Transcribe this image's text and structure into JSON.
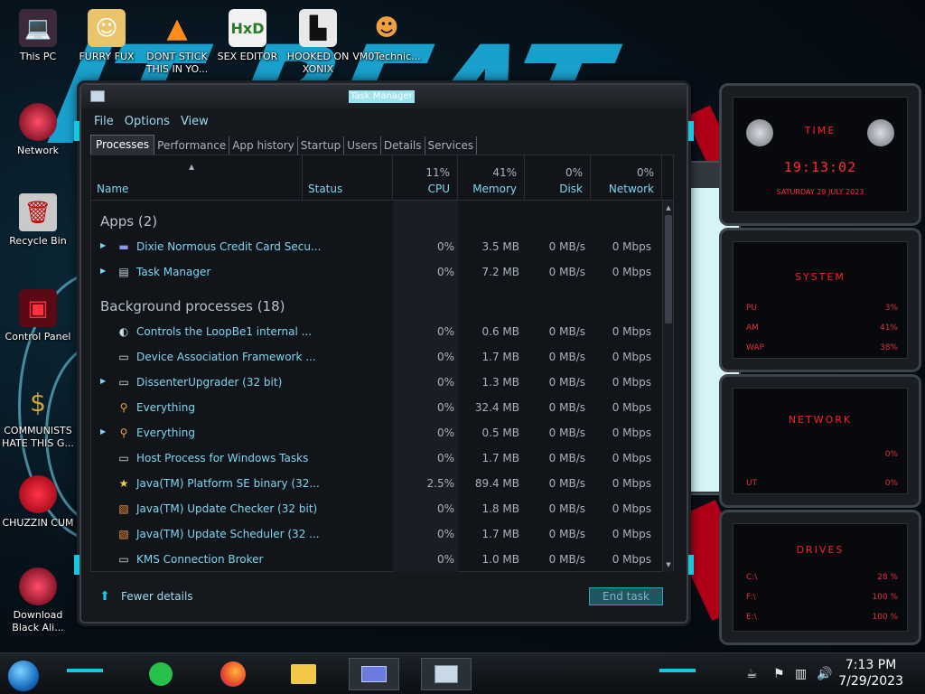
{
  "desktop": {
    "icons": [
      {
        "label": "This PC"
      },
      {
        "label": "FURRY FUX"
      },
      {
        "label": "DONT STICK THIS IN YO..."
      },
      {
        "label": "SEX EDITOR"
      },
      {
        "label": "HOOKED ON XONIX"
      },
      {
        "label": "VM0Technic..."
      },
      {
        "label": "Network"
      },
      {
        "label": "Recycle Bin"
      },
      {
        "label": "Control Panel"
      },
      {
        "label": "COMMUNISTS HATE THIS G..."
      },
      {
        "label": "CHUZZIN CUM"
      },
      {
        "label": "Download Black Ali..."
      }
    ]
  },
  "task_manager": {
    "title": "Task Manager",
    "menu": [
      "File",
      "Options",
      "View"
    ],
    "tabs": [
      "Processes",
      "Performance",
      "App history",
      "Startup",
      "Users",
      "Details",
      "Services"
    ],
    "active_tab": "Processes",
    "columns": {
      "name": "Name",
      "status": "Status",
      "cpu_pct": "11%",
      "cpu": "CPU",
      "mem_pct": "41%",
      "mem": "Memory",
      "disk_pct": "0%",
      "disk": "Disk",
      "net_pct": "0%",
      "net": "Network"
    },
    "groups": {
      "apps": "Apps (2)",
      "background": "Background processes (18)"
    },
    "apps": [
      {
        "name": "Dixie Normous Credit Card Secu...",
        "cpu": "0%",
        "mem": "3.5 MB",
        "disk": "0 MB/s",
        "net": "0 Mbps",
        "expand": true,
        "icon": "card-icon"
      },
      {
        "name": "Task Manager",
        "cpu": "0%",
        "mem": "7.2 MB",
        "disk": "0 MB/s",
        "net": "0 Mbps",
        "expand": true,
        "icon": "taskmgr-icon"
      }
    ],
    "background": [
      {
        "name": "Controls the LoopBe1 internal ...",
        "cpu": "0%",
        "mem": "0.6 MB",
        "disk": "0 MB/s",
        "net": "0 Mbps",
        "expand": false,
        "icon": "loop-icon"
      },
      {
        "name": "Device Association Framework ...",
        "cpu": "0%",
        "mem": "1.7 MB",
        "disk": "0 MB/s",
        "net": "0 Mbps",
        "expand": false,
        "icon": "window-icon"
      },
      {
        "name": "DissenterUpgrader (32 bit)",
        "cpu": "0%",
        "mem": "1.3 MB",
        "disk": "0 MB/s",
        "net": "0 Mbps",
        "expand": true,
        "icon": "window-icon"
      },
      {
        "name": "Everything",
        "cpu": "0%",
        "mem": "32.4 MB",
        "disk": "0 MB/s",
        "net": "0 Mbps",
        "expand": false,
        "icon": "search-icon"
      },
      {
        "name": "Everything",
        "cpu": "0%",
        "mem": "0.5 MB",
        "disk": "0 MB/s",
        "net": "0 Mbps",
        "expand": true,
        "icon": "search-icon"
      },
      {
        "name": "Host Process for Windows Tasks",
        "cpu": "0%",
        "mem": "1.7 MB",
        "disk": "0 MB/s",
        "net": "0 Mbps",
        "expand": false,
        "icon": "window-icon"
      },
      {
        "name": "Java(TM) Platform SE binary (32...",
        "cpu": "2.5%",
        "mem": "89.4 MB",
        "disk": "0 MB/s",
        "net": "0 Mbps",
        "expand": false,
        "icon": "star-icon"
      },
      {
        "name": "Java(TM) Update Checker (32 bit)",
        "cpu": "0%",
        "mem": "1.8 MB",
        "disk": "0 MB/s",
        "net": "0 Mbps",
        "expand": false,
        "icon": "java-icon"
      },
      {
        "name": "Java(TM) Update Scheduler (32 ...",
        "cpu": "0%",
        "mem": "1.7 MB",
        "disk": "0 MB/s",
        "net": "0 Mbps",
        "expand": false,
        "icon": "java-icon"
      },
      {
        "name": "KMS Connection Broker",
        "cpu": "0%",
        "mem": "1.0 MB",
        "disk": "0 MB/s",
        "net": "0 Mbps",
        "expand": false,
        "icon": "window-icon"
      }
    ],
    "fewer_details": "Fewer details",
    "end_task": "End task"
  },
  "gadgets": {
    "time": {
      "title": "TIME",
      "clock": "19:13:02",
      "date": "SATURDAY 29 JULY 2023"
    },
    "system": {
      "title": "SYSTEM",
      "rows": [
        {
          "label": "PU",
          "value": "3%"
        },
        {
          "label": "AM",
          "value": "41%"
        },
        {
          "label": "WAP",
          "value": "38%"
        }
      ]
    },
    "network": {
      "title": "NETWORK",
      "rows": [
        {
          "label": "",
          "value": "0%"
        },
        {
          "label": "UT",
          "value": "0%"
        }
      ]
    },
    "drives": {
      "title": "DRIVES",
      "rows": [
        {
          "label": "C:\\",
          "value": "28 %"
        },
        {
          "label": "F:\\",
          "value": "100 %"
        },
        {
          "label": "E:\\",
          "value": "100 %"
        }
      ]
    }
  },
  "taskbar": {
    "clock_time": "7:13 PM",
    "clock_date": "7/29/2023"
  },
  "colors": {
    "accent": "#19c6e0",
    "link": "#7fd6f2",
    "gadget_red": "#ff1e2e"
  }
}
